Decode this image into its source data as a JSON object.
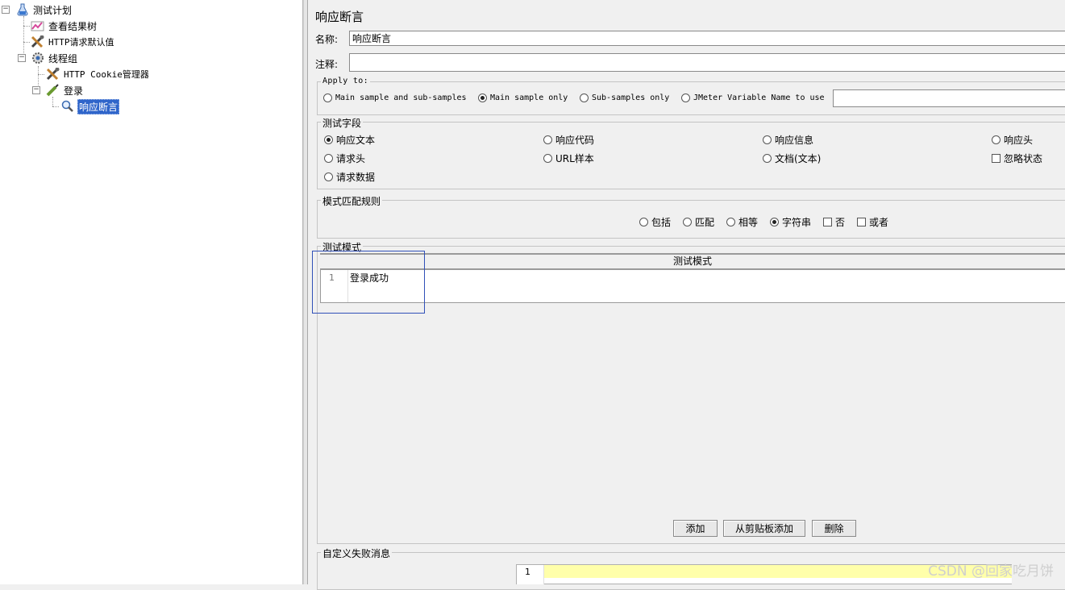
{
  "tree": {
    "nodes": [
      {
        "label": "测试计划",
        "icon": "flask-icon"
      },
      {
        "label": "查看结果树",
        "icon": "chart-listener-icon"
      },
      {
        "label": "HTTP请求默认值",
        "icon": "wrench-config-icon"
      },
      {
        "label": "线程组",
        "icon": "gear-threadgroup-icon"
      },
      {
        "label": "HTTP Cookie管理器",
        "icon": "wrench-config-icon"
      },
      {
        "label": "登录",
        "icon": "pen-sampler-icon"
      },
      {
        "label": "响应断言",
        "icon": "magnifier-assertion-icon"
      }
    ]
  },
  "panel": {
    "title": "响应断言",
    "name_label": "名称:",
    "name_value": "响应断言",
    "comment_label": "注释:",
    "comment_value": ""
  },
  "apply_to": {
    "title": "Apply to:",
    "options": [
      "Main sample and sub-samples",
      "Main sample only",
      "Sub-samples only",
      "JMeter Variable Name to use"
    ],
    "selected": "Main sample only",
    "variable_value": ""
  },
  "test_field": {
    "title": "测试字段",
    "options": [
      "响应文本",
      "响应代码",
      "响应信息",
      "响应头",
      "请求头",
      "URL样本",
      "文档(文本)",
      "请求数据"
    ],
    "selected": "响应文本",
    "ignore_status_label": "忽略状态",
    "ignore_status_checked": false
  },
  "pattern_rules": {
    "title": "模式匹配规则",
    "radios": [
      "包括",
      "匹配",
      "相等",
      "字符串"
    ],
    "selected": "字符串",
    "checks": [
      "否",
      "或者"
    ]
  },
  "test_patterns": {
    "title": "测试模式",
    "column_header": "测试模式",
    "rows": [
      {
        "line": "1",
        "text": "登录成功"
      }
    ],
    "buttons": {
      "add": "添加",
      "add_from_clipboard": "从剪贴板添加",
      "delete": "删除"
    }
  },
  "custom_failure": {
    "title": "自定义失败消息",
    "line": "1"
  },
  "watermark": "CSDN @回家吃月饼",
  "colors": {
    "selection": "#2f65ca",
    "editor_highlight": "#ffffaa",
    "annotation_box": "#3050b8"
  }
}
